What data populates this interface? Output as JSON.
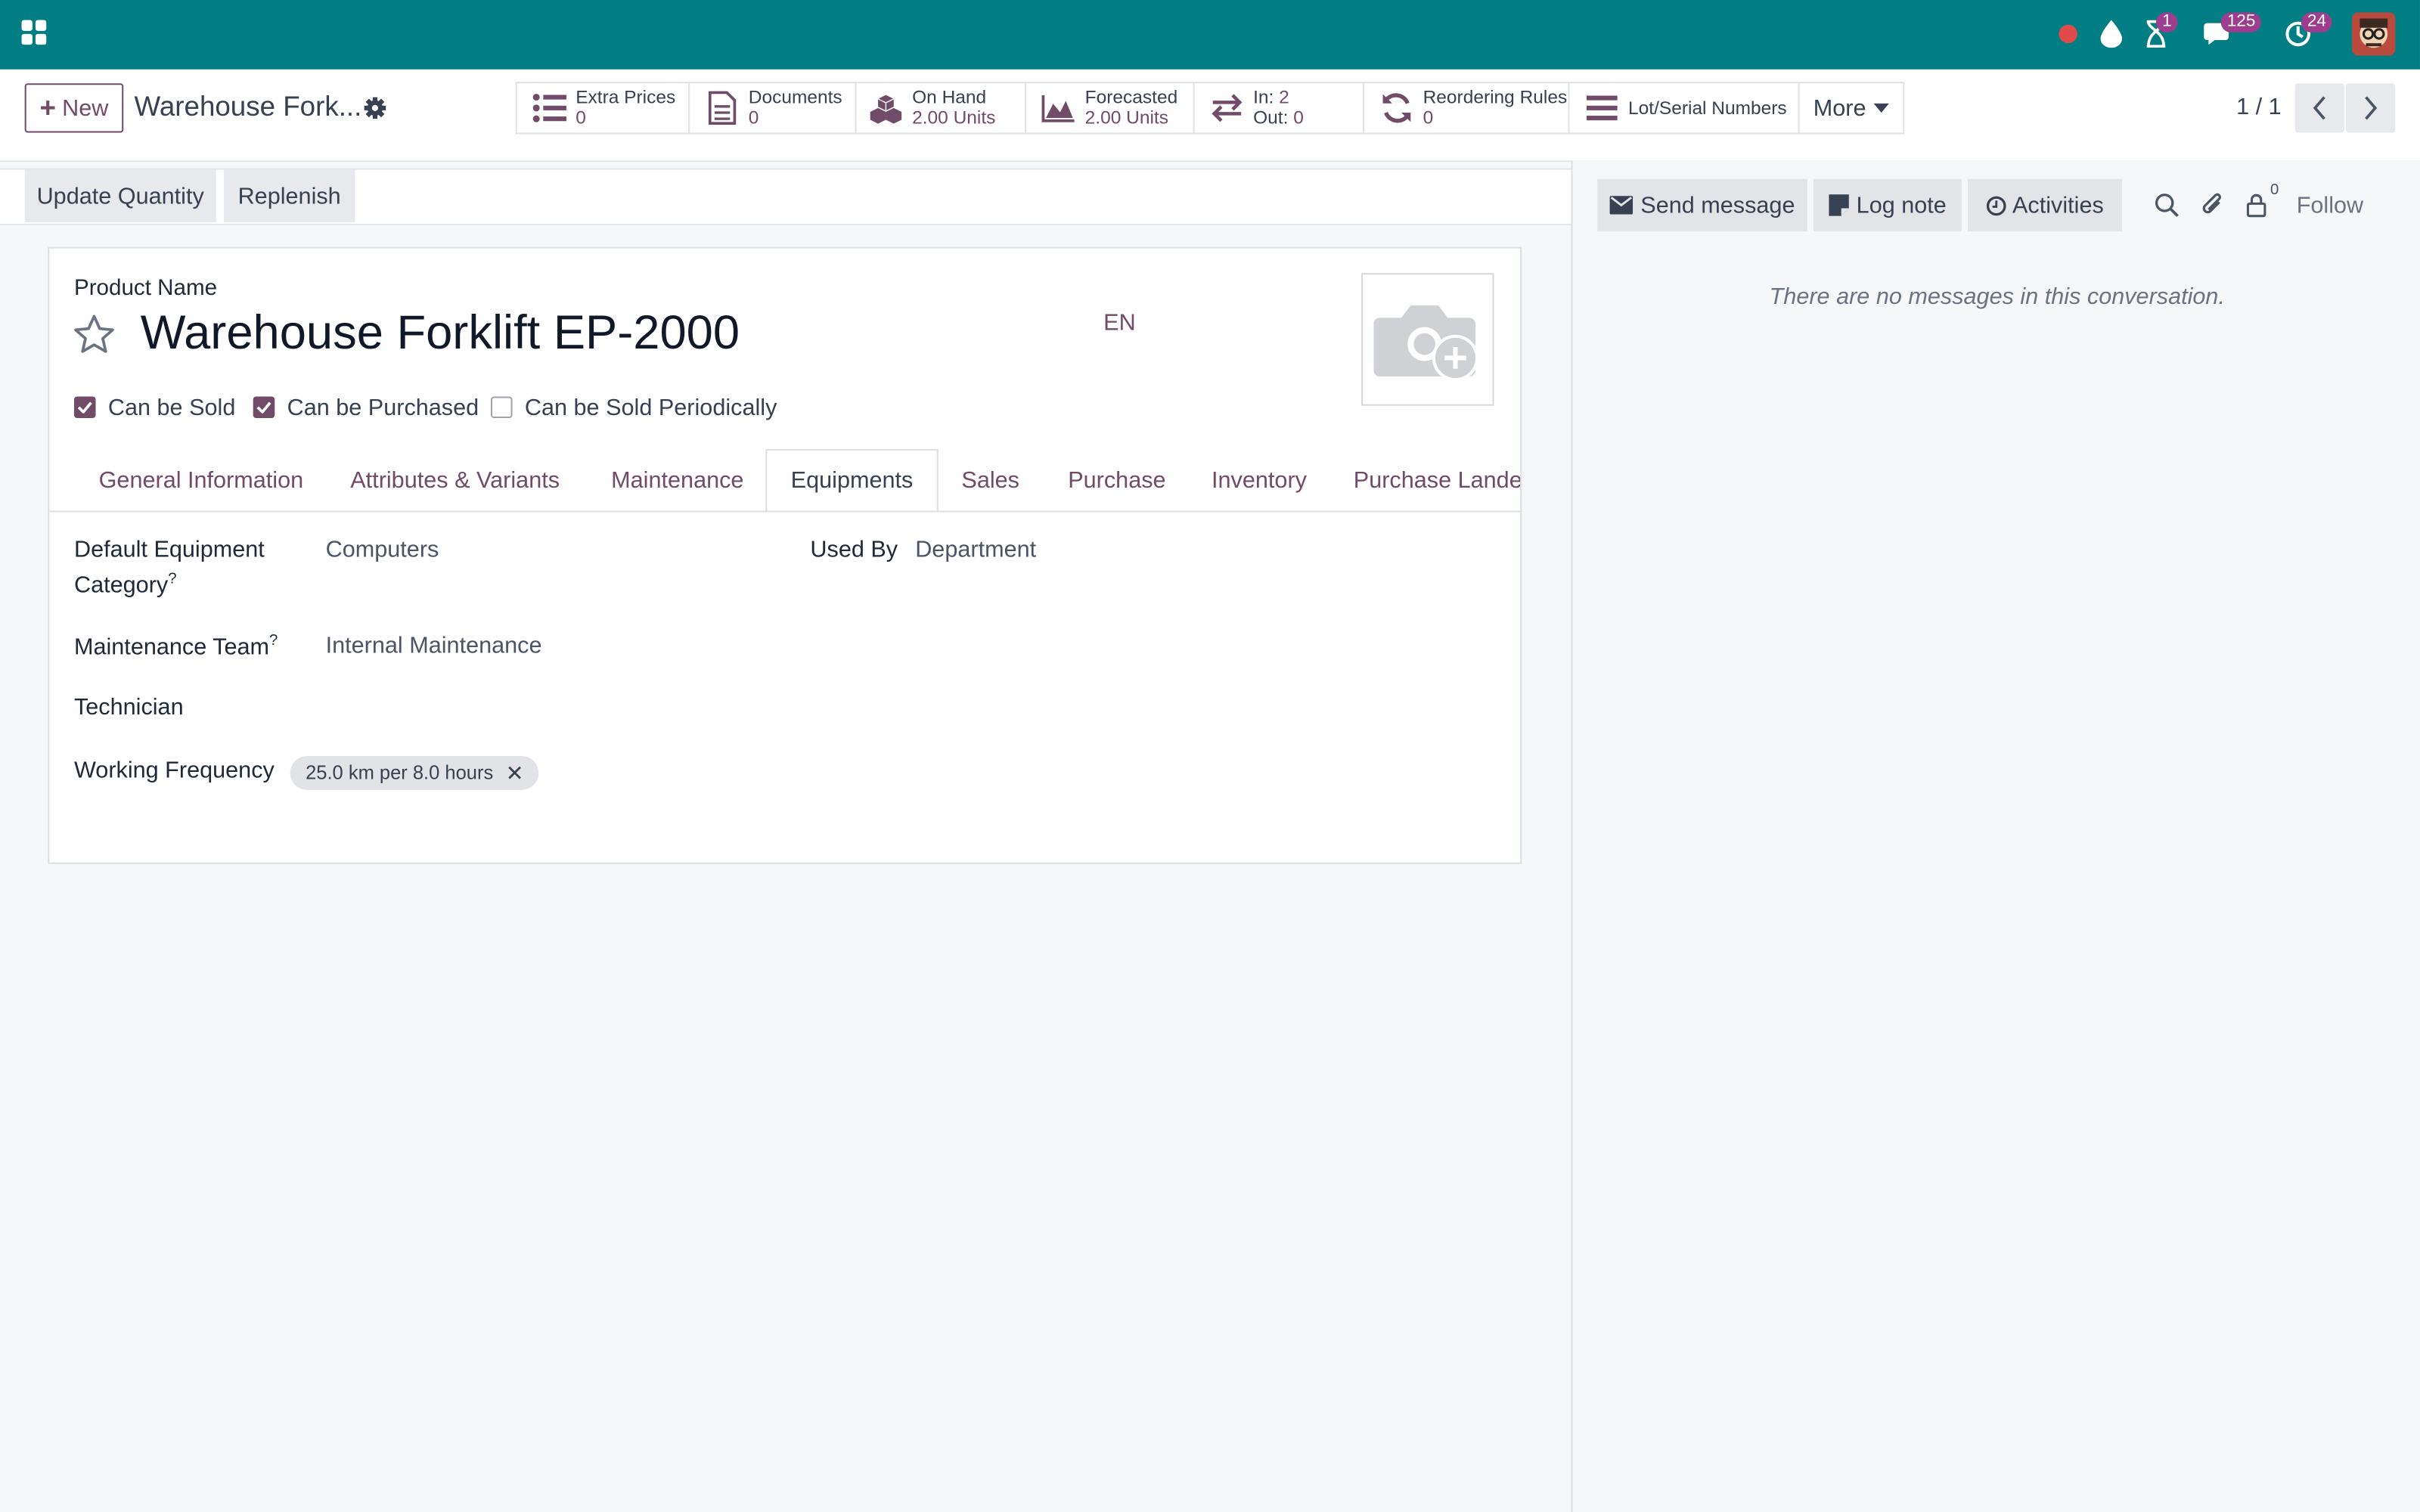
{
  "topbar": {
    "chat_badge": "125",
    "activity_badge": "1",
    "updates_badge": "24"
  },
  "control_panel": {
    "new_label": "New",
    "breadcrumb": "Warehouse Fork...",
    "smart_buttons": [
      {
        "title": "Extra Prices",
        "value": "0"
      },
      {
        "title": "Documents",
        "value": "0"
      },
      {
        "title": "On Hand",
        "value": "2.00 Units"
      },
      {
        "title": "Forecasted",
        "value": "2.00 Units"
      },
      {
        "in_label": "In:",
        "in_value": "2",
        "out_label": "Out:",
        "out_value": "0"
      },
      {
        "title": "Reordering Rules",
        "value": "0"
      },
      {
        "title": "Lot/Serial Numbers"
      }
    ],
    "more_label": "More",
    "pager": "1 / 1"
  },
  "statusbar": {
    "update_quantity": "Update Quantity",
    "replenish": "Replenish"
  },
  "form": {
    "product_name_label": "Product Name",
    "product_name": "Warehouse Forklift EP-2000",
    "lang": "EN",
    "can_be_sold": "Can be Sold",
    "can_be_purchased": "Can be Purchased",
    "can_be_sold_periodically": "Can be Sold Periodically",
    "tabs": [
      "General Information",
      "Attributes & Variants",
      "Maintenance",
      "Equipments",
      "Sales",
      "Purchase",
      "Inventory",
      "Purchase Landed"
    ],
    "default_equipment_category_label_1": "Default Equipment",
    "default_equipment_category_label_2": "Category",
    "default_equipment_category": "Computers",
    "used_by_label": "Used By",
    "used_by": "Department",
    "maintenance_team_label": "Maintenance Team",
    "maintenance_team": "Internal Maintenance",
    "technician_label": "Technician",
    "working_frequency_label": "Working Frequency",
    "working_frequency_tag": "25.0 km per 8.0 hours",
    "help_mark": "?"
  },
  "chatter": {
    "send_message": "Send message",
    "log_note": "Log note",
    "activities": "Activities",
    "followers_count": "0",
    "follow": "Follow",
    "no_messages": "There are no messages in this conversation."
  }
}
